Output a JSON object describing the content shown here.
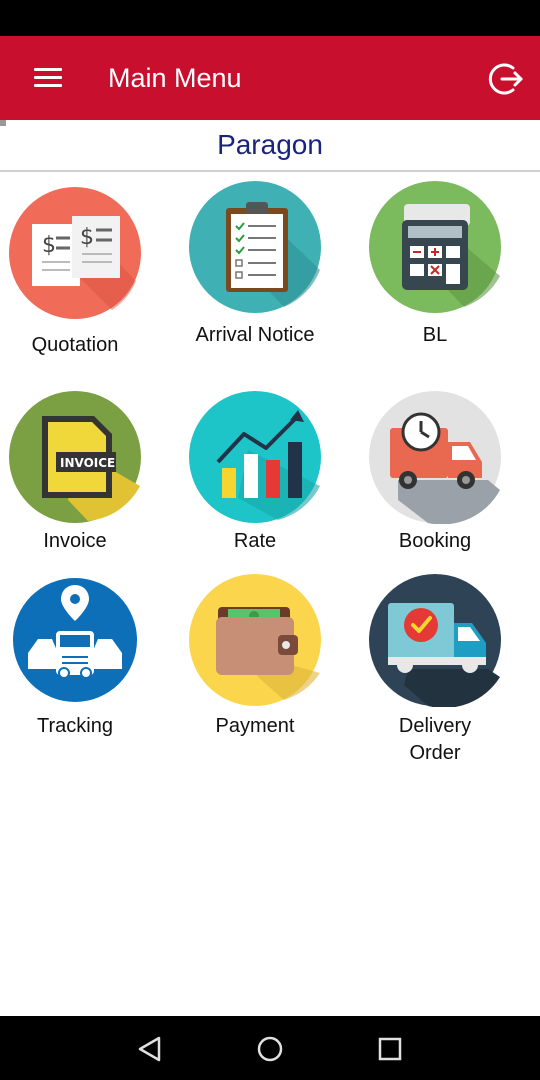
{
  "header": {
    "title": "Main Menu",
    "menu_icon": "hamburger-menu-icon",
    "logout_icon": "logout-icon",
    "color": "#c8102e"
  },
  "company": {
    "name": "Paragon",
    "color": "#1a237e"
  },
  "menu": [
    {
      "label": "Quotation",
      "icon": "quotation-icon",
      "color": "#f06b58"
    },
    {
      "label": "Arrival Notice",
      "icon": "arrival-notice-icon",
      "color": "#3fb0b4"
    },
    {
      "label": "BL",
      "icon": "bl-calculator-icon",
      "color": "#7cba5e"
    },
    {
      "label": "Invoice",
      "icon": "invoice-icon",
      "color": "#7aa043"
    },
    {
      "label": "Rate",
      "icon": "rate-chart-icon",
      "color": "#1ec5c8"
    },
    {
      "label": "Booking",
      "icon": "booking-truck-icon",
      "color": "#e2e2e2"
    },
    {
      "label": "Tracking",
      "icon": "tracking-icon",
      "color": "#0d6fb8"
    },
    {
      "label": "Payment",
      "icon": "payment-wallet-icon",
      "color": "#fbd54c"
    },
    {
      "label": "Delivery Order",
      "icon": "delivery-order-icon",
      "color": "#2f4357"
    }
  ],
  "nav": {
    "back_icon": "back-icon",
    "home_icon": "home-icon",
    "recents_icon": "recents-icon"
  }
}
